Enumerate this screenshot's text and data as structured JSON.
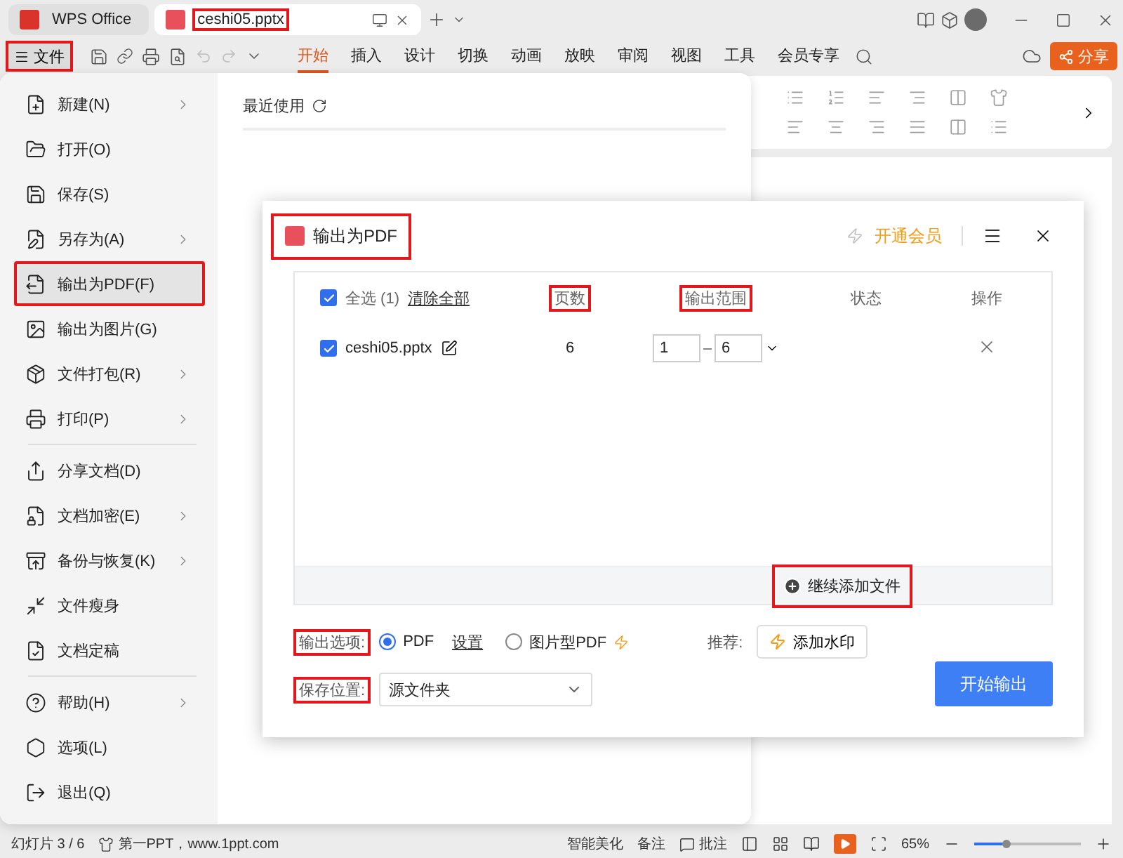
{
  "tabs": [
    {
      "label": "WPS Office",
      "kind": "home",
      "selected": false,
      "highlighted": false
    },
    {
      "label": "ceshi05.pptx",
      "kind": "doc",
      "selected": true,
      "highlighted": true
    }
  ],
  "file_button": {
    "label": "文件",
    "highlighted": true
  },
  "ribbon_tabs": [
    {
      "label": "开始",
      "selected": true
    },
    {
      "label": "插入",
      "selected": false
    },
    {
      "label": "设计",
      "selected": false
    },
    {
      "label": "切换",
      "selected": false
    },
    {
      "label": "动画",
      "selected": false
    },
    {
      "label": "放映",
      "selected": false
    },
    {
      "label": "审阅",
      "selected": false
    },
    {
      "label": "视图",
      "selected": false
    },
    {
      "label": "工具",
      "selected": false
    },
    {
      "label": "会员专享",
      "selected": false
    }
  ],
  "share_button": "分享",
  "file_menu": {
    "groups": [
      [
        {
          "label": "新建(N)",
          "submenu": true,
          "selected": false,
          "highlighted": false
        },
        {
          "label": "打开(O)",
          "submenu": false,
          "selected": false,
          "highlighted": false
        },
        {
          "label": "保存(S)",
          "submenu": false,
          "selected": false,
          "highlighted": false
        },
        {
          "label": "另存为(A)",
          "submenu": true,
          "selected": false,
          "highlighted": false
        },
        {
          "label": "输出为PDF(F)",
          "submenu": false,
          "selected": true,
          "highlighted": true
        },
        {
          "label": "输出为图片(G)",
          "submenu": false,
          "selected": false,
          "highlighted": false
        },
        {
          "label": "文件打包(R)",
          "submenu": true,
          "selected": false,
          "highlighted": false
        },
        {
          "label": "打印(P)",
          "submenu": true,
          "selected": false,
          "highlighted": false
        }
      ],
      [
        {
          "label": "分享文档(D)",
          "submenu": false,
          "selected": false,
          "highlighted": false
        },
        {
          "label": "文档加密(E)",
          "submenu": true,
          "selected": false,
          "highlighted": false
        },
        {
          "label": "备份与恢复(K)",
          "submenu": true,
          "selected": false,
          "highlighted": false
        },
        {
          "label": "文件瘦身",
          "submenu": false,
          "selected": false,
          "highlighted": false
        },
        {
          "label": "文档定稿",
          "submenu": false,
          "selected": false,
          "highlighted": false
        }
      ],
      [
        {
          "label": "帮助(H)",
          "submenu": true,
          "selected": false,
          "highlighted": false
        },
        {
          "label": "选项(L)",
          "submenu": false,
          "selected": false,
          "highlighted": false
        },
        {
          "label": "退出(Q)",
          "submenu": false,
          "selected": false,
          "highlighted": false
        }
      ]
    ],
    "recent_title": "最近使用"
  },
  "dialog": {
    "title": "输出为PDF",
    "highlighted": true,
    "vip": "开通会员",
    "select_all": {
      "label": "全选 (1)",
      "checked": true
    },
    "clear": "清除全部",
    "columns": [
      {
        "label": "页数",
        "highlighted": true
      },
      {
        "label": "输出范围",
        "highlighted": true
      },
      {
        "label": "状态",
        "highlighted": false
      },
      {
        "label": "操作",
        "highlighted": false
      }
    ],
    "rows": [
      {
        "checked": true,
        "name": "ceshi05.pptx",
        "pages": "6",
        "from": "1",
        "to": "6"
      }
    ],
    "add_file": {
      "label": "继续添加文件",
      "highlighted": true
    },
    "options": {
      "label": "输出选项:",
      "highlighted": true,
      "settings": "设置",
      "choices": [
        {
          "label": "PDF",
          "selected": true
        },
        {
          "label": "图片型PDF",
          "selected": false
        }
      ]
    },
    "recommend": {
      "label": "推荐:",
      "button": "添加水印"
    },
    "save": {
      "label": "保存位置:",
      "highlighted": true,
      "value": "源文件夹"
    },
    "start": "开始输出"
  },
  "status_bar": {
    "slide": "幻灯片 3 / 6",
    "theme": "第一PPT，www.1ppt.com",
    "beautify": "智能美化",
    "notes": "备注",
    "comments": "批注",
    "zoom": "65%",
    "zoom_slider": {
      "level": 0.3
    }
  }
}
